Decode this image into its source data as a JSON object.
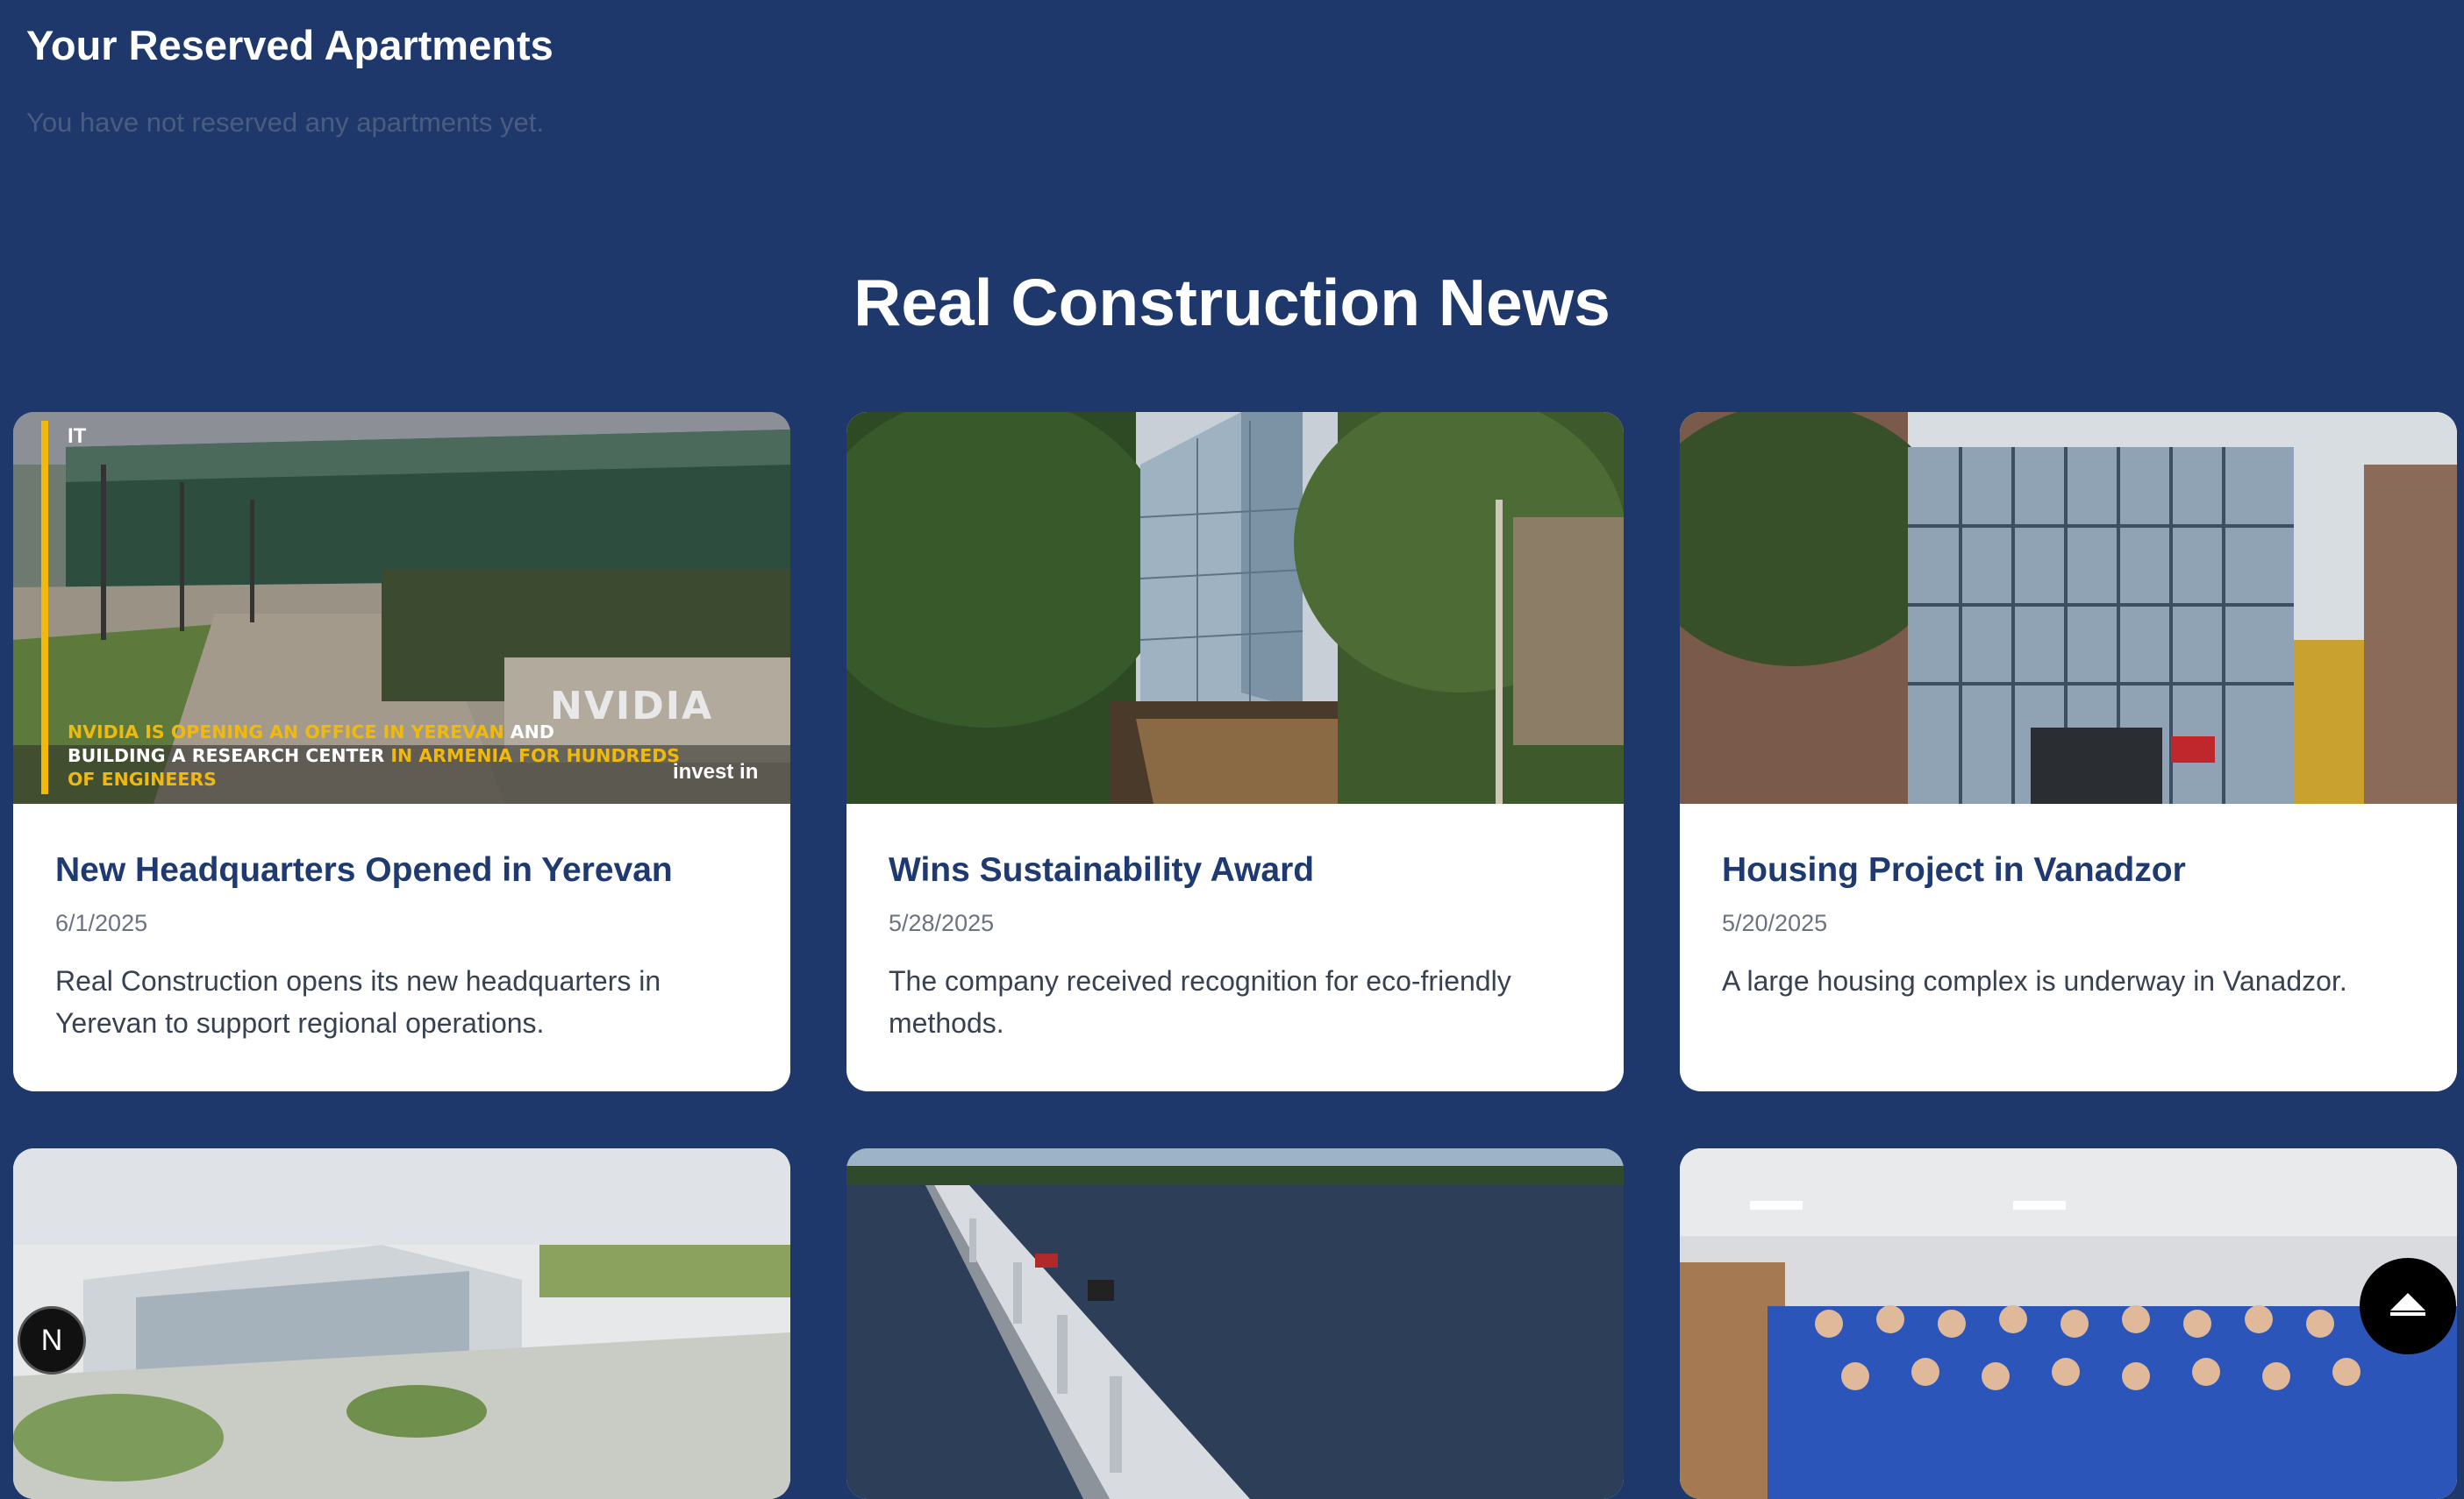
{
  "reserved": {
    "title": "Your Reserved Apartments",
    "empty_message": "You have not reserved any apartments yet."
  },
  "news": {
    "title": "Real Construction News",
    "cards": [
      {
        "image_alt": "NVIDIA office building with stairs",
        "title": "New Headquarters Opened in Yerevan",
        "date": "6/1/2025",
        "summary": "Real Construction opens its new headquarters in Yerevan to support regional operations.",
        "overlay": {
          "tag": "IT",
          "logo": "NVIDIA",
          "line1_highlight": "NVIDIA is opening an office in Yerevan",
          "line1_rest": " and",
          "line2_start": "building a research center ",
          "line2_highlight": "in Armenia for hundreds",
          "line3_highlight": "of engineers",
          "brand": "invest in"
        }
      },
      {
        "image_alt": "Glass building among trees",
        "title": "Wins Sustainability Award",
        "date": "5/28/2025",
        "summary": "The company received recognition for eco-friendly methods."
      },
      {
        "image_alt": "Glass and brick building facade",
        "title": "Housing Project in Vanadzor",
        "date": "5/20/2025",
        "summary": "A large housing complex is underway in Vanadzor."
      },
      {
        "image_alt": "Architectural rendering of a modern building"
      },
      {
        "image_alt": "Long bridge over water"
      },
      {
        "image_alt": "Group of students in blue t-shirts"
      }
    ]
  },
  "fab": {
    "dev_badge": "N",
    "scroll_top_icon": "chevron-up-icon"
  },
  "colors": {
    "background": "#1e386b",
    "card_title": "#1e3a70",
    "accent_yellow": "#f0b90b"
  }
}
